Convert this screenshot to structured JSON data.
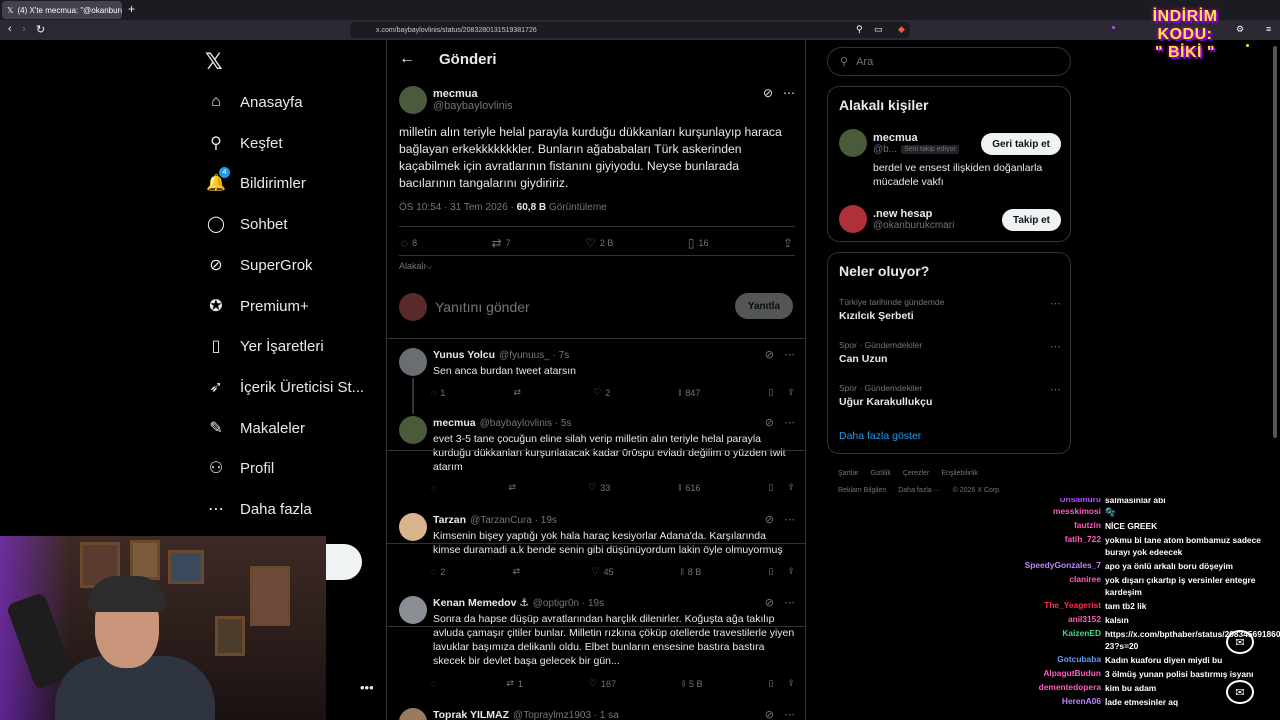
{
  "browser": {
    "tab_title": "(4) X'te mecmua: \"@okanburuk",
    "tab_close": "×",
    "new_tab": "+",
    "url": "x.com/baybaylovlinis/status/2083280131519381726"
  },
  "promo": {
    "line1": "İNDİRİM KODU:",
    "line2": "\" BİKİ \""
  },
  "nav": {
    "logo": "𝕏",
    "items": [
      {
        "label": "Anasayfa",
        "icon": "⌂"
      },
      {
        "label": "Keşfet",
        "icon": "⚲"
      },
      {
        "label": "Bildirimler",
        "icon": "🔔",
        "badge": "4"
      },
      {
        "label": "Sohbet",
        "icon": "◯"
      },
      {
        "label": "SuperGrok",
        "icon": "⊘"
      },
      {
        "label": "Premium+",
        "icon": "✪"
      },
      {
        "label": "Yer İşaretleri",
        "icon": "▯"
      },
      {
        "label": "İçerik Üreticisi St...",
        "icon": "➶"
      },
      {
        "label": "Makaleler",
        "icon": "✎"
      },
      {
        "label": "Profil",
        "icon": "⚇"
      },
      {
        "label": "Daha fazla",
        "icon": "⋯"
      }
    ],
    "more_dots": "•••"
  },
  "header": {
    "title": "Gönderi",
    "back": "←"
  },
  "main_tweet": {
    "name": "mecmua",
    "handle": "@baybaylovlinis",
    "text": "milletin alın teriyle helal parayla kurduğu dükkanları kurşunlayıp haraca bağlayan erkekkkkkkkler. Bunların ağababaları Türk askerinden kaçabilmek için avratlarının fistanını giyiyodu. Neyse bunlarada bacılarının tangalarını giydiririz.",
    "time": "ÖS 10:54 · 31 Tem 2026 · ",
    "views": "60,8 B",
    "views_label": " Görüntüleme",
    "replies": "8",
    "reposts": "7",
    "likes": "2 B",
    "bookmarks": "16",
    "relevant": "Alakalı⌵"
  },
  "reply_box": {
    "placeholder": "Yanıtını gönder",
    "button": "Yanıtla"
  },
  "replies": [
    {
      "name": "Yunus Yolcu",
      "handle": "@fyunuus_ · 7s",
      "text": "Sen anca burdan tweet atarsın",
      "replies": "1",
      "reposts": "",
      "likes": "2",
      "views": "847",
      "avatar": "#6a6d72"
    },
    {
      "name": "mecmua",
      "handle": "@baybaylovlinis · 5s",
      "text": "evet 3-5 tane çocuğun eline silah verip milletin alın teriyle helal parayla kurduğu dükkanları kurşunlatacak kadar 0r0spu evladı değilim o yüzden twit atarım",
      "replies": "",
      "reposts": "",
      "likes": "33",
      "views": "616",
      "avatar": "#4b5a3a"
    },
    {
      "name": "Tarzan",
      "handle": "@TarzanCura · 19s",
      "text": "Kimsenin bişey yaptığı yok hala haraç kesiyorlar Adana'da. Karşılarında kimse duramadi a.k bende senin gibi düşünüyordum lakin öyle olmuyormuş",
      "replies": "2",
      "reposts": "",
      "likes": "45",
      "views": "8 B",
      "avatar": "#d9b38c"
    },
    {
      "name": "Kenan Memedov ⚓",
      "handle": "@optigr0n · 19s",
      "text": "Sonra da hapse düşüp avratlarından harçlık dilenirler. Koğuşta ağa takılıp avluda çamaşır çitiler bunlar. Milletin rızkına çöküp otellerde travestilerle yiyen lavuklar başımıza delikanlı oldu. Elbet bunların ensesine bastıra bastıra skecek bir devlet başa gelecek bir gün...",
      "replies": "",
      "reposts": "1",
      "likes": "167",
      "views": "5 B",
      "avatar": "#8a8f96"
    },
    {
      "name": "Toprak YILMAZ",
      "handle": "@Topraylmz1903 · 1 sa",
      "text": "",
      "replies": "",
      "reposts": "",
      "likes": "",
      "views": "",
      "avatar": "#9a7b60"
    }
  ],
  "search": {
    "placeholder": "Ara",
    "icon": "search-icon"
  },
  "related": {
    "title": "Alakalı kişiler",
    "people": [
      {
        "name": "mecmua",
        "handle": "@b...",
        "follows_you": "Seni takip ediyor",
        "button": "Geri takip et",
        "bio": "berdel ve ensest ilişkiden doğanlarla mücadele vakfı",
        "avatar": "#4b5a3a"
      },
      {
        "name": ".new hesap",
        "handle": "@okanburukcmari",
        "button": "Takip et",
        "avatar": "#b0303a"
      }
    ]
  },
  "trends": {
    "title": "Neler oluyor?",
    "items": [
      {
        "context": "Türkiye tarihinde gündemde",
        "name": "Kızılcık Şerbeti"
      },
      {
        "context": "Spor · Gündemdekiler",
        "name": "Can Uzun"
      },
      {
        "context": "Spor · Gündemdekiler",
        "name": "Uğur Karakullukçu"
      }
    ],
    "show_more": "Daha fazla göster"
  },
  "footer": {
    "row1": [
      "Şartlar",
      "Gizlilik",
      "Çerezler",
      "Erişilebilirlik"
    ],
    "row2": [
      "Reklam Bilgileri",
      "Daha fazla ···",
      "© 2026 X Corp."
    ]
  },
  "chat": [
    {
      "user": "Unsamuru",
      "color": "#b44cff",
      "msg": "salmasınlar abi"
    },
    {
      "user": "messkimosi",
      "color": "#ff5cbd",
      "msg": "🫧"
    },
    {
      "user": "fautzin",
      "color": "#ff5cbd",
      "msg": "NİCE GREEK"
    },
    {
      "user": "fatih_722",
      "color": "#ff5cbd",
      "msg": "yokmu bi tane atom bombamuz sadece burayı yok edeecek"
    },
    {
      "user": "SpeedyGonzales_7",
      "color": "#c084fc",
      "msg": "apo ya önlü arkalı boru döşeyim"
    },
    {
      "user": "claniree",
      "color": "#ff5cbd",
      "msg": "yok dışarı çıkartıp iş versinler entegre kardeşim"
    },
    {
      "user": "The_Yeagerist",
      "color": "#ff2e4d",
      "msg": "tam tb2 lik"
    },
    {
      "user": "anil3152",
      "color": "#ff5cbd",
      "msg": "kalsın"
    },
    {
      "user": "KaizenED",
      "color": "#3ddc84",
      "msg": "https://x.com/bpthaber/status/20834569186017325​23?s=20"
    },
    {
      "user": "Gotcubaba",
      "color": "#5aa0ff",
      "msg": "Kadın kuaforu diyen miydi bu"
    },
    {
      "user": "AlpagutBudun",
      "color": "#ff5cbd",
      "msg": "3 ölmüş yunan polisi bastırmış isyanı"
    },
    {
      "user": "dementedopera",
      "color": "#ff5cbd",
      "msg": "kim bu adam"
    },
    {
      "user": "HerenA06",
      "color": "#c084fc",
      "msg": "İade etmesinler aq"
    }
  ]
}
